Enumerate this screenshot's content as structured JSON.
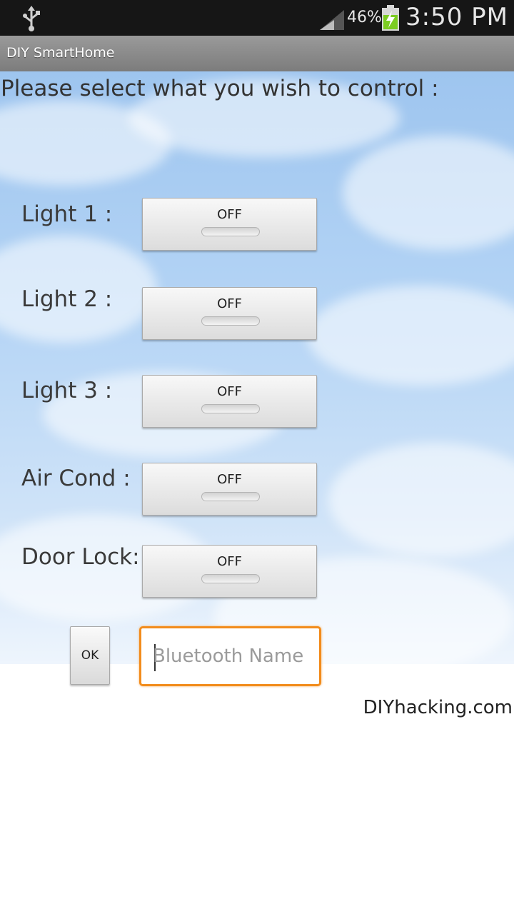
{
  "status_bar": {
    "battery_percent": "46%",
    "time": "3:50 PM",
    "icons": [
      "usb-icon",
      "signal-icon",
      "battery-charging-icon"
    ]
  },
  "app": {
    "title": "DIY SmartHome"
  },
  "prompt": "Please select what you wish to control :",
  "controls": [
    {
      "label": "Light 1 :",
      "state": "OFF"
    },
    {
      "label": "Light 2 :",
      "state": "OFF"
    },
    {
      "label": "Light 3 :",
      "state": "OFF"
    },
    {
      "label": "Air Cond :",
      "state": "OFF"
    },
    {
      "label": "Door Lock:",
      "state": "OFF"
    }
  ],
  "ok_label": "OK",
  "bluetooth": {
    "placeholder": "Bluetooth Name",
    "value": ""
  },
  "credit": "DIYhacking.com",
  "colors": {
    "focus_border": "#f28c1c",
    "statusbar": "#161616",
    "titlebar": "#8a8a8a"
  }
}
